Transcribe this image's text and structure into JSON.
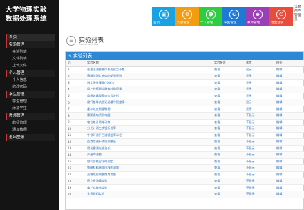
{
  "sidebar": {
    "brand_line1": "大学物理实验",
    "brand_line2": "数据处理系统",
    "sections": [
      {
        "label": "首页",
        "items": []
      },
      {
        "label": "实验管理",
        "items": [
          "实验列表",
          "文件列表",
          "上传文件"
        ]
      },
      {
        "label": "个人管理",
        "items": [
          "个人信息",
          "修改密码"
        ]
      },
      {
        "label": "学生管理",
        "items": [
          "学生管理",
          "添加学生"
        ]
      },
      {
        "label": "教师管理",
        "items": [
          "教师管理",
          "添加教师"
        ]
      },
      {
        "label": "退出登录",
        "items": []
      }
    ]
  },
  "tiles": [
    {
      "label": "首页",
      "color": "#1aa1e1",
      "icon": "monitor-icon"
    },
    {
      "label": "实验管理",
      "color": "#f39c12",
      "icon": "gear-icon"
    },
    {
      "label": "个人管理",
      "color": "#2ecc40",
      "icon": "user-icon"
    },
    {
      "label": "学生管理",
      "color": "#1f7ad6",
      "icon": "users-icon"
    },
    {
      "label": "教师管理",
      "color": "#9b3fb5",
      "icon": "teacher-icon"
    },
    {
      "label": "退出登录",
      "color": "#e74c3c",
      "icon": "power-icon"
    }
  ],
  "toplink": "当前用户 管理员",
  "page": {
    "title": "实验列表",
    "subtitle": "Experiment List",
    "panel_title": "实验列表"
  },
  "table": {
    "headers": [
      "ID",
      "实验名称",
      "实验报告",
      "状态",
      "操作"
    ],
    "rows": [
      [
        "1",
        "驻波法测量液体表面张力系数",
        "查看",
        "显示",
        "编辑"
      ],
      [
        "2",
        "落球法测定液体的黏滞系数",
        "查看",
        "显示",
        "编辑"
      ],
      [
        "3",
        "测定弹性模量(拉伸法)",
        "查看",
        "显示",
        "编辑"
      ],
      [
        "4",
        "用三线摆测定刚体转动惯量",
        "查看",
        "显示",
        "编辑"
      ],
      [
        "5",
        "用示波器观察电信号波形",
        "查看",
        "显示",
        "编辑"
      ],
      [
        "6",
        "用气垫导轨验证动量守恒定律",
        "查看",
        "显示",
        "编辑"
      ],
      [
        "7",
        "霍尔效应测量磁场",
        "查看",
        "显示",
        "编辑"
      ],
      [
        "8",
        "惠斯通电桥测电阻",
        "查看",
        "不显示",
        "编辑"
      ],
      [
        "9",
        "电位差计测电动势",
        "查看",
        "不显示",
        "编辑"
      ],
      [
        "10",
        "分光计测三棱镜折射率",
        "查看",
        "不显示",
        "编辑"
      ],
      [
        "11",
        "牛顿环测平凸透镜曲率半径",
        "查看",
        "不显示",
        "编辑"
      ],
      [
        "12",
        "迈克尔逊干涉仪测波长",
        "查看",
        "不显示",
        "编辑"
      ],
      [
        "13",
        "用光栅测光波波长",
        "查看",
        "不显示",
        "编辑"
      ],
      [
        "14",
        "声速的测量",
        "查看",
        "不显示",
        "编辑"
      ],
      [
        "15",
        "空气比热容比的测定",
        "查看",
        "不显示",
        "编辑"
      ],
      [
        "16",
        "铁磁材料磁滞回线的测量",
        "查看",
        "不显示",
        "编辑"
      ],
      [
        "17",
        "光电效应测普朗克常量",
        "查看",
        "不显示",
        "编辑"
      ],
      [
        "18",
        "密立根油滴实验",
        "查看",
        "不显示",
        "编辑"
      ],
      [
        "19",
        "弗兰克赫兹实验",
        "查看",
        "不显示",
        "编辑"
      ],
      [
        "20",
        "全息照相实验",
        "查看",
        "不显示",
        "编辑"
      ]
    ]
  }
}
